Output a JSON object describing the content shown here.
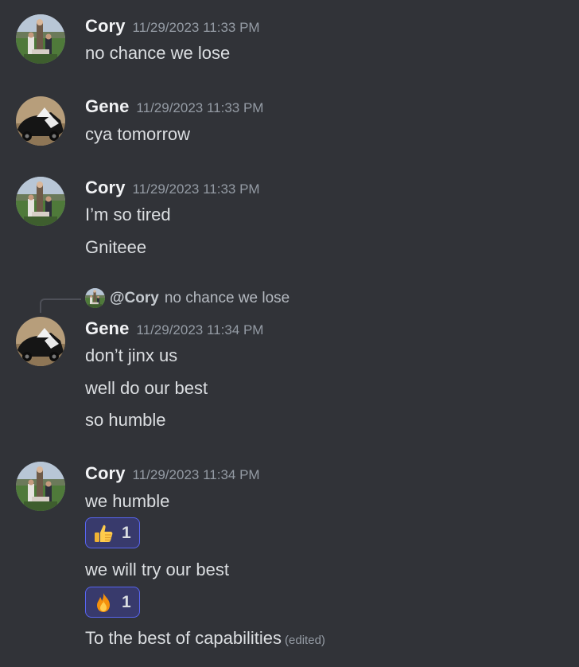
{
  "colors": {
    "background": "#313338",
    "author": "#f2f3f5",
    "timestamp": "#949ba4",
    "message": "#dbdee1",
    "reaction_bg": "#383a6c",
    "reaction_border": "#5865f2"
  },
  "messages": [
    {
      "author": "Cory",
      "timestamp": "11/29/2023 11:33 PM",
      "avatar": "cory-avatar-icon",
      "lines": [
        "no chance we lose"
      ]
    },
    {
      "author": "Gene",
      "timestamp": "11/29/2023 11:33 PM",
      "avatar": "gene-avatar-icon",
      "lines": [
        "cya tomorrow"
      ]
    },
    {
      "author": "Cory",
      "timestamp": "11/29/2023 11:33 PM",
      "avatar": "cory-avatar-icon",
      "lines": [
        "I’m so tired",
        "Gniteee"
      ]
    },
    {
      "author": "Gene",
      "timestamp": "11/29/2023 11:34 PM",
      "avatar": "gene-avatar-icon",
      "reply": {
        "mention": "@Cory",
        "text": "no chance we lose"
      },
      "lines": [
        "don’t jinx us",
        "well do our best",
        "so humble"
      ]
    },
    {
      "author": "Cory",
      "timestamp": "11/29/2023 11:34 PM",
      "avatar": "cory-avatar-icon",
      "lines": [
        "we humble",
        "we will try our best",
        "To the best of capabilities"
      ],
      "edited_label": "(edited)",
      "reactions": [
        {
          "emoji": "thumbs-up-icon",
          "count": "1"
        },
        {
          "emoji": "fire-icon",
          "count": "1"
        }
      ]
    }
  ]
}
